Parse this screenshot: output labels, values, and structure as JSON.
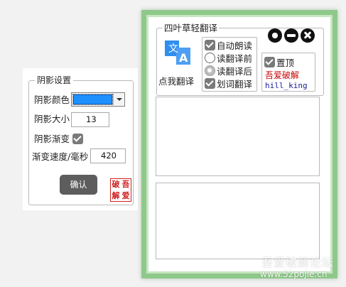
{
  "settings": {
    "group_title": "阴影设置",
    "shadow_color_label": "阴影颜色",
    "shadow_color_value": "#1E90FF",
    "shadow_size_label": "阴影大小",
    "shadow_size_value": "13",
    "shadow_gradient_label": "阴影渐变",
    "shadow_gradient_checked": true,
    "gradient_speed_label": "渐变速度/毫秒",
    "gradient_speed_value": "420",
    "confirm_label": "确认",
    "seal_chars": [
      "破",
      "吾",
      "解",
      "爱"
    ]
  },
  "main": {
    "title": "四叶草轻翻译",
    "icons": [
      "gear-icon",
      "minimize-icon",
      "close-icon"
    ],
    "translate_button_label": "点我翻译",
    "options": {
      "auto_read": {
        "label": "自动朗读",
        "checked": true
      },
      "read_before": {
        "label": "读翻译前",
        "selected": false
      },
      "read_after": {
        "label": "读翻译后",
        "selected": true
      },
      "select_translate": {
        "label": "划词翻译",
        "checked": true
      }
    },
    "pin_label": "置顶",
    "pin_checked": true,
    "brand_cn": "吾爱破解",
    "brand_user": "hill_king",
    "source_text": "",
    "result_text": ""
  },
  "watermark": {
    "site_cn": "吾爱破解论坛",
    "site_url": "www.52pojie.cn"
  },
  "colors": {
    "window_border": "#8FC98A",
    "accent_blue": "#1E90FF",
    "translate_icon_blue": "#2F8EF0",
    "brand_red": "#CC0000"
  }
}
